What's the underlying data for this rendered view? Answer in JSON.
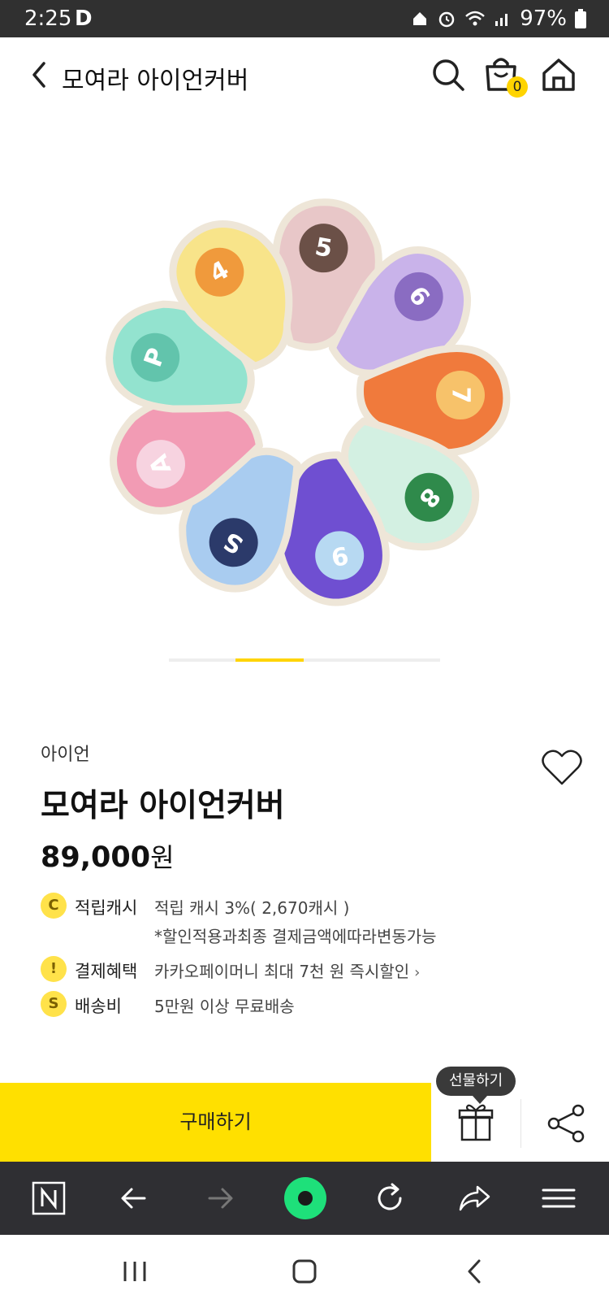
{
  "status_bar": {
    "time": "2:25",
    "app_letter": "D",
    "battery": "97%"
  },
  "header": {
    "title": "모여라 아이언커버",
    "cart_count": "0"
  },
  "product_image": {
    "covers": [
      {
        "label": "5",
        "color": "#e8c7c8",
        "badge": "#6b5047"
      },
      {
        "label": "6",
        "color": "#c9b3ea",
        "badge": "#8a6cc2"
      },
      {
        "label": "7",
        "color": "#f07a3c",
        "badge": "#f7c26a"
      },
      {
        "label": "8",
        "color": "#d3f0e2",
        "badge": "#2f8a4b"
      },
      {
        "label": "9",
        "color": "#6f4fd1",
        "badge": "#b7d9f2"
      },
      {
        "label": "S",
        "color": "#a9ccf0",
        "badge": "#2b3a6a"
      },
      {
        "label": "A",
        "color": "#f29bb4",
        "badge": "#f7d3e0"
      },
      {
        "label": "P",
        "color": "#93e3cf",
        "badge": "#62c4ac"
      },
      {
        "label": "4",
        "color": "#f8e48a",
        "badge": "#f09a3c"
      }
    ]
  },
  "product": {
    "category": "아이언",
    "name": "모여라 아이언커버",
    "price_number": "89,000",
    "price_unit": "원"
  },
  "info": {
    "points": {
      "icon": "C",
      "label": "적립캐시",
      "value": "적립 캐시 3%( 2,670캐시 )",
      "note": "*할인적용과최종 결제금액에따라변동가능"
    },
    "payment": {
      "icon": "!",
      "label": "결제혜택",
      "value": "카카오페이머니 최대 7천 원 즉시할인"
    },
    "shipping": {
      "icon": "S",
      "label": "배송비",
      "value": "5만원 이상 무료배송"
    }
  },
  "actions": {
    "buy_label": "구매하기",
    "gift_tooltip": "선물하기"
  },
  "colors": {
    "accent": "#ffe000",
    "status_bar_bg": "#303030",
    "browser_bar_bg": "#2f2f33"
  }
}
